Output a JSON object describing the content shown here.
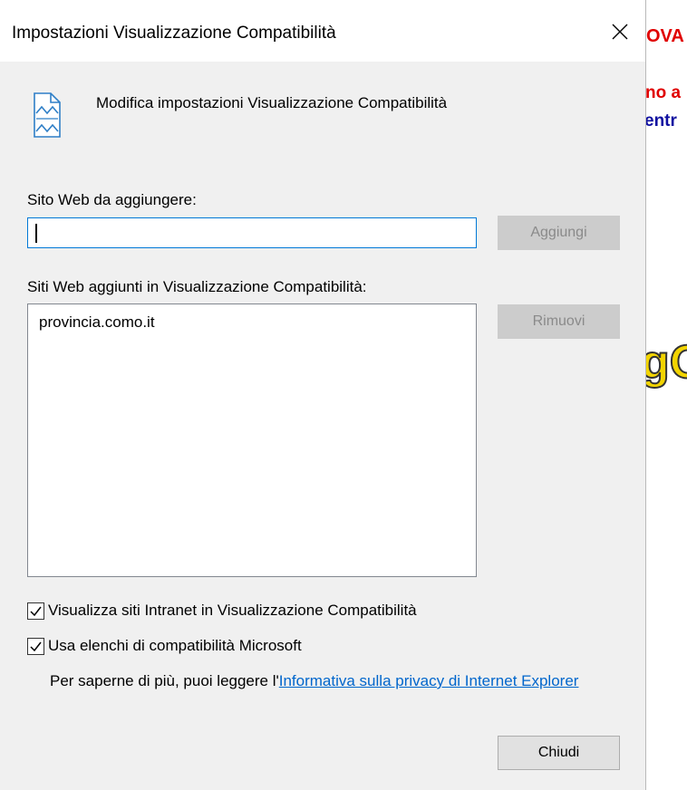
{
  "dialog": {
    "title": "Impostazioni Visualizzazione Compatibilità",
    "close_glyph": "✕",
    "header_text": "Modifica impostazioni Visualizzazione Compatibilità",
    "icon": "compat-view-page-icon"
  },
  "add_site": {
    "label": "Sito Web da aggiungere:",
    "value": "",
    "button_label": "Aggiungi"
  },
  "sites": {
    "label": "Siti Web aggiunti in Visualizzazione Compatibilità:",
    "items": [
      "provincia.como.it"
    ],
    "remove_label": "Rimuovi"
  },
  "options": {
    "intranet": {
      "label": "Visualizza siti Intranet in Visualizzazione Compatibilità",
      "checked": true
    },
    "microsoft_lists": {
      "label": "Usa elenchi di compatibilità Microsoft",
      "checked": true
    }
  },
  "info": {
    "prefix": "Per saperne di più, puoi leggere l'",
    "link": "Informativa sulla privacy di Internet Explorer"
  },
  "close_button_label": "Chiudi",
  "background_page": {
    "fragment_1": "OVA",
    "fragment_2": "no a",
    "fragment_3": "entr",
    "fragment_4": "gO"
  },
  "colors": {
    "dialog_bg": "#f0f0f0",
    "input_border_focus": "#0078d7",
    "link": "#0066cc",
    "bg_red": "#e00000",
    "bg_blue": "#1010a0",
    "bg_yellow": "#f2d400"
  }
}
